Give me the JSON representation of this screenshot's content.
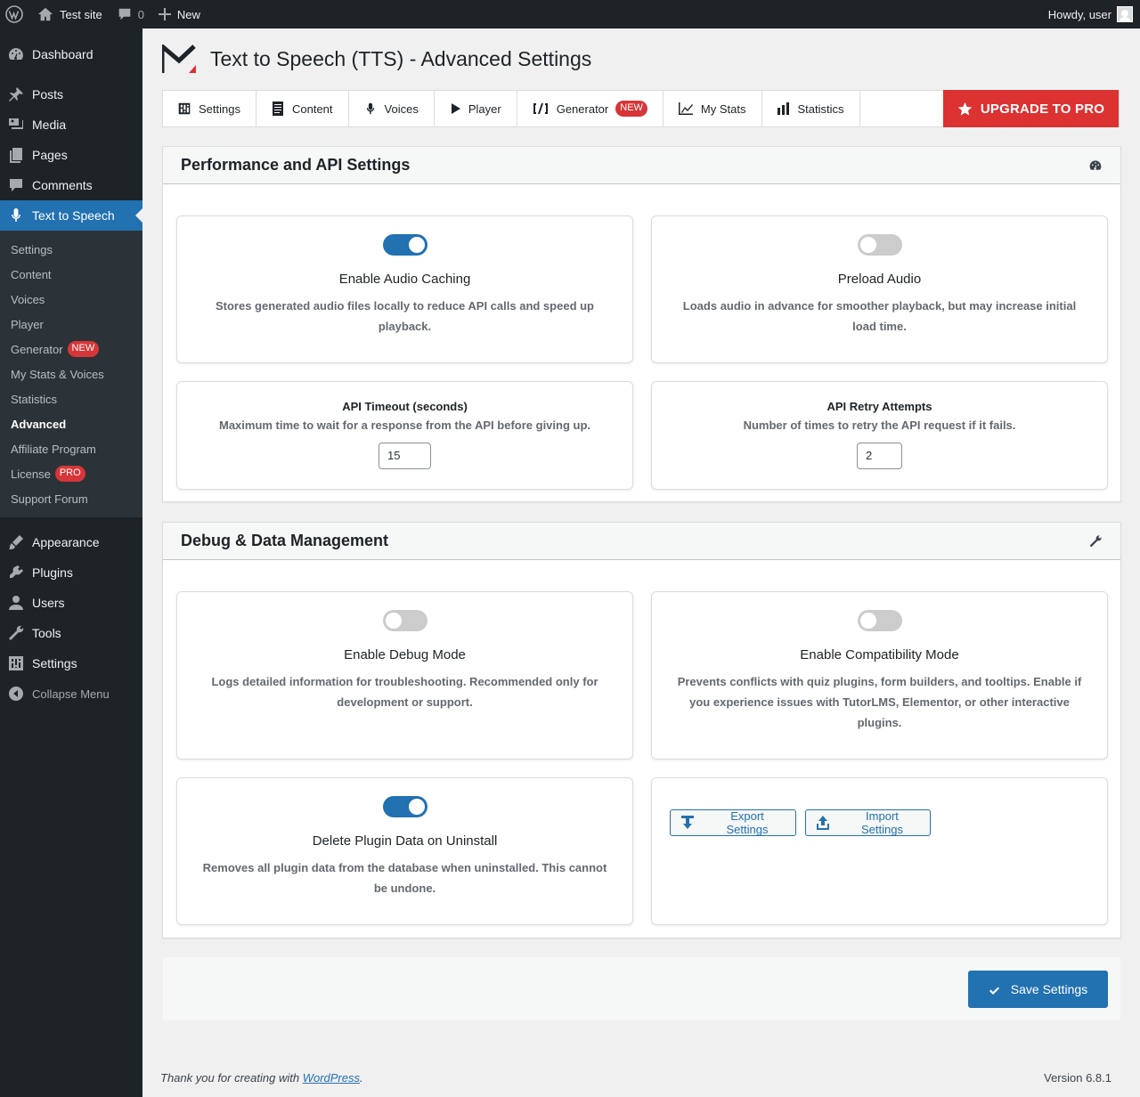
{
  "adminbar": {
    "site_name": "Test site",
    "comments_count": "0",
    "new_label": "New",
    "howdy": "Howdy, user"
  },
  "sidebar": {
    "items_top": [
      {
        "label": "Dashboard",
        "icon": "dashboard-icon"
      },
      {
        "label": "Posts",
        "icon": "pin-icon"
      },
      {
        "label": "Media",
        "icon": "media-icon"
      },
      {
        "label": "Pages",
        "icon": "pages-icon"
      },
      {
        "label": "Comments",
        "icon": "comment-icon"
      },
      {
        "label": "Text to Speech",
        "icon": "microphone-icon"
      }
    ],
    "submenu": [
      {
        "label": "Settings"
      },
      {
        "label": "Content"
      },
      {
        "label": "Voices"
      },
      {
        "label": "Player"
      },
      {
        "label": "Generator",
        "badge": "NEW"
      },
      {
        "label": "My Stats & Voices"
      },
      {
        "label": "Statistics"
      },
      {
        "label": "Advanced"
      },
      {
        "label": "Affiliate Program"
      },
      {
        "label": "License",
        "badge": "PRO"
      },
      {
        "label": "Support Forum"
      }
    ],
    "items_bottom": [
      {
        "label": "Appearance",
        "icon": "brush-icon"
      },
      {
        "label": "Plugins",
        "icon": "plug-icon"
      },
      {
        "label": "Users",
        "icon": "user-icon"
      },
      {
        "label": "Tools",
        "icon": "wrench-icon"
      },
      {
        "label": "Settings",
        "icon": "settings-icon"
      }
    ],
    "collapse_label": "Collapse Menu"
  },
  "page": {
    "title": "Text to Speech (TTS) - Advanced Settings"
  },
  "tabs": [
    {
      "label": "Settings",
      "icon": "settings-icon"
    },
    {
      "label": "Content",
      "icon": "document-icon"
    },
    {
      "label": "Voices",
      "icon": "microphone-icon"
    },
    {
      "label": "Player",
      "icon": "play-icon"
    },
    {
      "label": "Generator",
      "icon": "shortcode-icon",
      "badge": "NEW"
    },
    {
      "label": "My Stats",
      "icon": "chart-line-icon"
    },
    {
      "label": "Statistics",
      "icon": "chart-bar-icon"
    }
  ],
  "upgrade_label": "UPGRADE TO PRO",
  "performance": {
    "title": "Performance and API Settings",
    "audio_caching": {
      "enabled": true,
      "title": "Enable Audio Caching",
      "desc": "Stores generated audio files locally to reduce API calls and speed up playback."
    },
    "preload_audio": {
      "enabled": false,
      "title": "Preload Audio",
      "desc": "Loads audio in advance for smoother playback, but may increase initial load time."
    },
    "api_timeout": {
      "title": "API Timeout (seconds)",
      "desc": "Maximum time to wait for a response from the API before giving up.",
      "value": "15"
    },
    "api_retry": {
      "title": "API Retry Attempts",
      "desc": "Number of times to retry the API request if it fails.",
      "value": "2"
    }
  },
  "debug": {
    "title": "Debug & Data Management",
    "debug_mode": {
      "enabled": false,
      "title": "Enable Debug Mode",
      "desc": "Logs detailed information for troubleshooting. Recommended only for development or support."
    },
    "compat_mode": {
      "enabled": false,
      "title": "Enable Compatibility Mode",
      "desc": "Prevents conflicts with quiz plugins, form builders, and tooltips. Enable if you experience issues with TutorLMS, Elementor, or other interactive plugins."
    },
    "delete_data": {
      "enabled": true,
      "title": "Delete Plugin Data on Uninstall",
      "desc": "Removes all plugin data from the database when uninstalled. This cannot be undone."
    },
    "export_label": "Export Settings",
    "import_label": "Import Settings"
  },
  "save_label": "Save Settings",
  "footer": {
    "thanks_prefix": "Thank you for creating with ",
    "wp_link": "WordPress",
    "thanks_suffix": ".",
    "version": "Version 6.8.1"
  },
  "colors": {
    "accent": "#2271b1",
    "upgrade": "#dc3232",
    "adminbar": "#1d2327"
  }
}
